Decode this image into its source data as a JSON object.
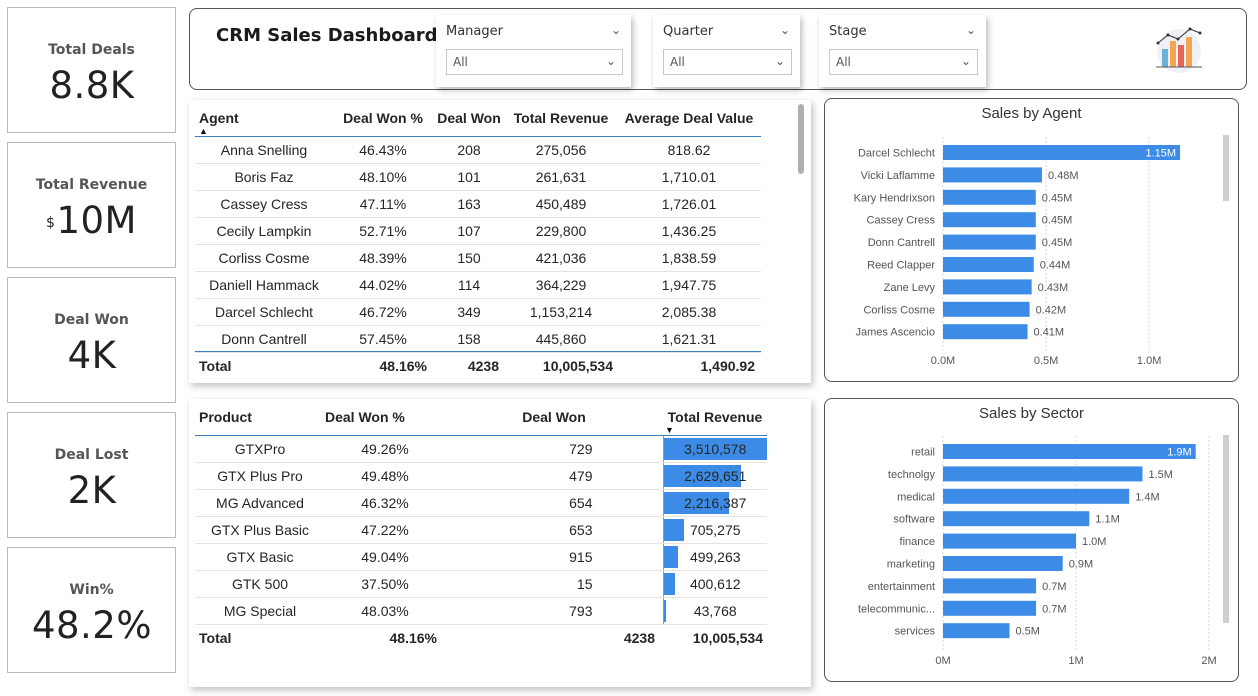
{
  "kpis": [
    {
      "label": "Total Deals",
      "prefix": "",
      "value": "8.8K"
    },
    {
      "label": "Total Revenue",
      "prefix": "$",
      "value": "10M"
    },
    {
      "label": "Deal Won",
      "prefix": "",
      "value": "4K"
    },
    {
      "label": "Deal Lost",
      "prefix": "",
      "value": "2K"
    },
    {
      "label": "Win%",
      "prefix": "",
      "value": "48.2%"
    }
  ],
  "header": {
    "title": "CRM Sales Dashboard",
    "slicers": [
      {
        "label": "Manager",
        "value": "All"
      },
      {
        "label": "Quarter",
        "value": "All"
      },
      {
        "label": "Stage",
        "value": "All"
      }
    ],
    "logo_icon": "bar-chart-logo-icon"
  },
  "agent_table": {
    "columns": [
      "Agent",
      "Deal Won %",
      "Deal Won",
      "Total Revenue",
      "Average Deal Value"
    ],
    "rows": [
      [
        "Anna Snelling",
        "46.43%",
        "208",
        "275,056",
        "818.62"
      ],
      [
        "Boris Faz",
        "48.10%",
        "101",
        "261,631",
        "1,710.01"
      ],
      [
        "Cassey Cress",
        "47.11%",
        "163",
        "450,489",
        "1,726.01"
      ],
      [
        "Cecily Lampkin",
        "52.71%",
        "107",
        "229,800",
        "1,436.25"
      ],
      [
        "Corliss Cosme",
        "48.39%",
        "150",
        "421,036",
        "1,838.59"
      ],
      [
        "Daniell Hammack",
        "44.02%",
        "114",
        "364,229",
        "1,947.75"
      ],
      [
        "Darcel Schlecht",
        "46.72%",
        "349",
        "1,153,214",
        "2,085.38"
      ],
      [
        "Donn Cantrell",
        "57.45%",
        "158",
        "445,860",
        "1,621.31"
      ]
    ],
    "total": [
      "Total",
      "48.16%",
      "4238",
      "10,005,534",
      "1,490.92"
    ]
  },
  "product_table": {
    "columns": [
      "Product",
      "Deal Won %",
      "Deal Won",
      "Total Revenue"
    ],
    "rows": [
      {
        "product": "GTXPro",
        "won_pct": "49.26%",
        "won": "729",
        "revenue": "3,510,578",
        "revenue_value": 3510578
      },
      {
        "product": "GTX Plus Pro",
        "won_pct": "49.48%",
        "won": "479",
        "revenue": "2,629,651",
        "revenue_value": 2629651
      },
      {
        "product": "MG Advanced",
        "won_pct": "46.32%",
        "won": "654",
        "revenue": "2,216,387",
        "revenue_value": 2216387
      },
      {
        "product": "GTX Plus Basic",
        "won_pct": "47.22%",
        "won": "653",
        "revenue": "705,275",
        "revenue_value": 705275
      },
      {
        "product": "GTX Basic",
        "won_pct": "49.04%",
        "won": "915",
        "revenue": "499,263",
        "revenue_value": 499263
      },
      {
        "product": "GTK 500",
        "won_pct": "37.50%",
        "won": "15",
        "revenue": "400,612",
        "revenue_value": 400612
      },
      {
        "product": "MG Special",
        "won_pct": "48.03%",
        "won": "793",
        "revenue": "43,768",
        "revenue_value": 43768
      }
    ],
    "total": [
      "Total",
      "48.16%",
      "4238",
      "10,005,534"
    ],
    "bar_color": "#3c8ce7"
  },
  "chart_data": [
    {
      "type": "bar",
      "orientation": "horizontal",
      "title": "Sales by Agent",
      "categories": [
        "Darcel Schlecht",
        "Vicki Laflamme",
        "Kary Hendrixson",
        "Cassey Cress",
        "Donn Cantrell",
        "Reed Clapper",
        "Zane Levy",
        "Corliss Cosme",
        "James Ascencio"
      ],
      "values": [
        1.15,
        0.48,
        0.45,
        0.45,
        0.45,
        0.44,
        0.43,
        0.42,
        0.41
      ],
      "value_labels": [
        "1.15M",
        "0.48M",
        "0.45M",
        "0.45M",
        "0.45M",
        "0.44M",
        "0.43M",
        "0.42M",
        "0.41M"
      ],
      "xlim": [
        0,
        1.3
      ],
      "xticks": [
        0,
        0.5,
        1.0
      ],
      "xtick_labels": [
        "0.0M",
        "0.5M",
        "1.0M"
      ],
      "grid": true,
      "color": "#3c8ce7"
    },
    {
      "type": "bar",
      "orientation": "horizontal",
      "title": "Sales by Sector",
      "categories": [
        "retail",
        "technolgy",
        "medical",
        "software",
        "finance",
        "marketing",
        "entertainment",
        "telecommunic...",
        "services"
      ],
      "values": [
        1.9,
        1.5,
        1.4,
        1.1,
        1.0,
        0.9,
        0.7,
        0.7,
        0.5
      ],
      "value_labels": [
        "1.9M",
        "1.5M",
        "1.4M",
        "1.1M",
        "1.0M",
        "0.9M",
        "0.7M",
        "0.7M",
        "0.5M"
      ],
      "xlim": [
        0,
        2.0
      ],
      "xticks": [
        0,
        1,
        2
      ],
      "xtick_labels": [
        "0M",
        "1M",
        "2M"
      ],
      "grid": true,
      "color": "#3c8ce7"
    }
  ]
}
